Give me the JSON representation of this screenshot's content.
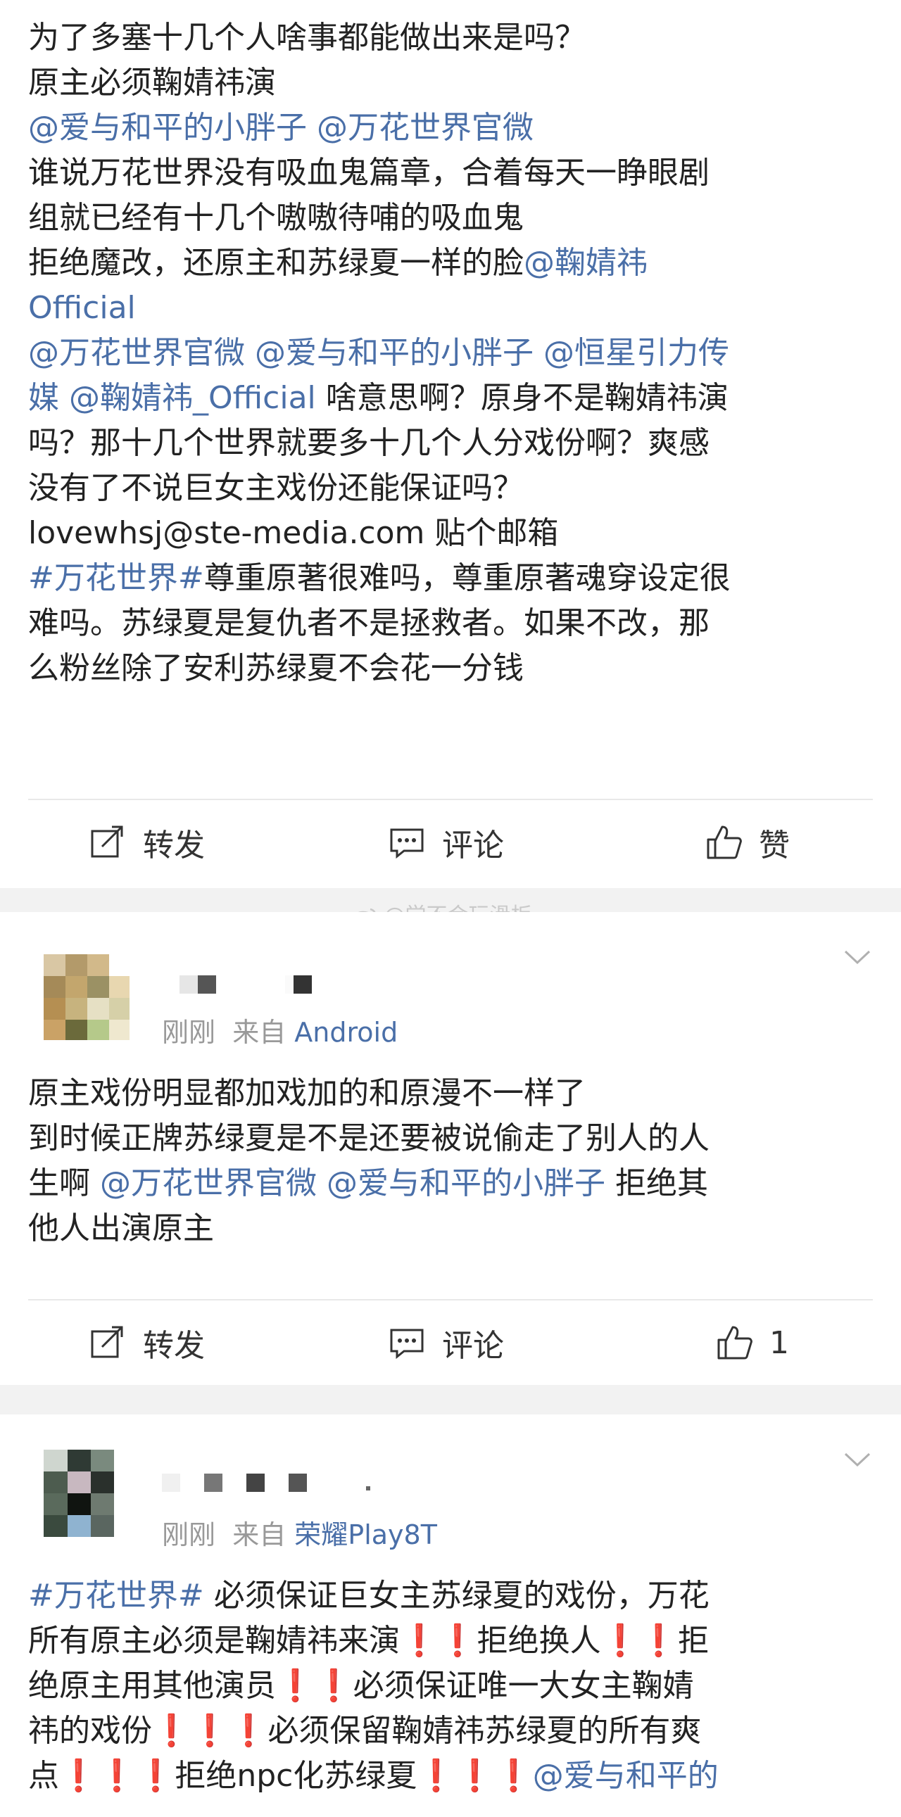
{
  "post": {
    "lines": [
      {
        "segments": [
          {
            "t": "为了多塞十几个人啥事都能做出来是吗？",
            "k": "text"
          }
        ]
      },
      {
        "segments": [
          {
            "t": "原主必须鞠婧祎演",
            "k": "text"
          }
        ]
      },
      {
        "segments": [
          {
            "t": "@爱与和平的小胖子 @万花世界官微",
            "k": "link"
          }
        ]
      },
      {
        "segments": [
          {
            "t": "谁说万花世界没有吸血鬼篇章，合着每天一睁眼剧",
            "k": "text"
          }
        ]
      },
      {
        "segments": [
          {
            "t": "组就已经有十几个嗷嗷待哺的吸血鬼",
            "k": "text"
          }
        ]
      },
      {
        "segments": [
          {
            "t": "拒绝魔改，还原主和苏绿夏一样的脸",
            "k": "text"
          },
          {
            "t": "@鞠婧祎",
            "k": "link"
          }
        ]
      },
      {
        "segments": [
          {
            "t": " Official",
            "k": "link"
          }
        ]
      },
      {
        "segments": [
          {
            "t": "@万花世界官微 @爱与和平的小胖子 @恒星引力传",
            "k": "link"
          }
        ]
      },
      {
        "segments": [
          {
            "t": "媒 @鞠婧祎_Official",
            "k": "link"
          },
          {
            "t": " 啥意思啊？原身不是鞠婧祎演",
            "k": "text"
          }
        ]
      },
      {
        "segments": [
          {
            "t": "吗？那十几个世界就要多十几个人分戏份啊？爽感",
            "k": "text"
          }
        ]
      },
      {
        "segments": [
          {
            "t": "没有了不说巨女主戏份还能保证吗？",
            "k": "text"
          }
        ]
      },
      {
        "segments": [
          {
            "t": "lovewhsj@ste-media.com",
            "k": "text"
          },
          {
            "t": " 贴个邮箱",
            "k": "text"
          }
        ]
      },
      {
        "segments": [
          {
            "t": "#万花世界#",
            "k": "link"
          },
          {
            "t": "尊重原著很难吗，尊重原著魂穿设定很",
            "k": "text"
          }
        ]
      },
      {
        "segments": [
          {
            "t": "难吗。苏绿夏是复仇者不是拯救者。如果不改，那",
            "k": "text"
          }
        ]
      },
      {
        "segments": [
          {
            "t": "么粉丝除了安利苏绿夏不会花一分钱",
            "k": "text"
          }
        ]
      }
    ],
    "actions": {
      "repost": "转发",
      "comment": "评论",
      "like": "赞"
    }
  },
  "watermark": "@学不会玩滑板",
  "comments": [
    {
      "meta_time": "刚刚",
      "meta_from": "来自",
      "meta_source": "Android",
      "lines": [
        {
          "segments": [
            {
              "t": "原主戏份明显都加戏加的和原漫不一样了",
              "k": "text"
            }
          ]
        },
        {
          "segments": [
            {
              "t": "到时候正牌苏绿夏是不是还要被说偷走了别人的人",
              "k": "text"
            }
          ]
        },
        {
          "segments": [
            {
              "t": "生啊 ",
              "k": "text"
            },
            {
              "t": "@万花世界官微 @爱与和平的小胖子",
              "k": "link"
            },
            {
              "t": " 拒绝其",
              "k": "text"
            }
          ]
        },
        {
          "segments": [
            {
              "t": "他人出演原主",
              "k": "text"
            }
          ]
        }
      ],
      "actions": {
        "repost": "转发",
        "comment": "评论",
        "like": "1"
      }
    },
    {
      "meta_time": "刚刚",
      "meta_from": "来自",
      "meta_source": "荣耀Play8T",
      "lines": [
        {
          "segments": [
            {
              "t": "#万花世界#",
              "k": "link"
            },
            {
              "t": " 必须保证巨女主苏绿夏的戏份，万花",
              "k": "text"
            }
          ]
        },
        {
          "segments": [
            {
              "t": "所有原主必须是鞠婧祎来演",
              "k": "text"
            },
            {
              "t": "❗❗",
              "k": "ex"
            },
            {
              "t": "拒绝换人",
              "k": "text"
            },
            {
              "t": "❗❗",
              "k": "ex"
            },
            {
              "t": "拒",
              "k": "text"
            }
          ]
        },
        {
          "segments": [
            {
              "t": "绝原主用其他演员",
              "k": "text"
            },
            {
              "t": "❗❗",
              "k": "ex"
            },
            {
              "t": "必须保证唯一大女主鞠婧",
              "k": "text"
            }
          ]
        },
        {
          "segments": [
            {
              "t": "祎的戏份",
              "k": "text"
            },
            {
              "t": "❗❗❗",
              "k": "ex"
            },
            {
              "t": "必须保留鞠婧祎苏绿夏的所有爽",
              "k": "text"
            }
          ]
        },
        {
          "segments": [
            {
              "t": "点",
              "k": "text"
            },
            {
              "t": "❗❗❗",
              "k": "ex"
            },
            {
              "t": "拒绝npc化苏绿夏",
              "k": "text"
            },
            {
              "t": "❗❗❗",
              "k": "ex"
            },
            {
              "t": "@爱与和平的",
              "k": "link"
            }
          ]
        }
      ]
    }
  ],
  "colors": {
    "link": "#4a6fa8",
    "text": "#222222",
    "muted": "#999999",
    "divider": "#f2f2f2"
  }
}
